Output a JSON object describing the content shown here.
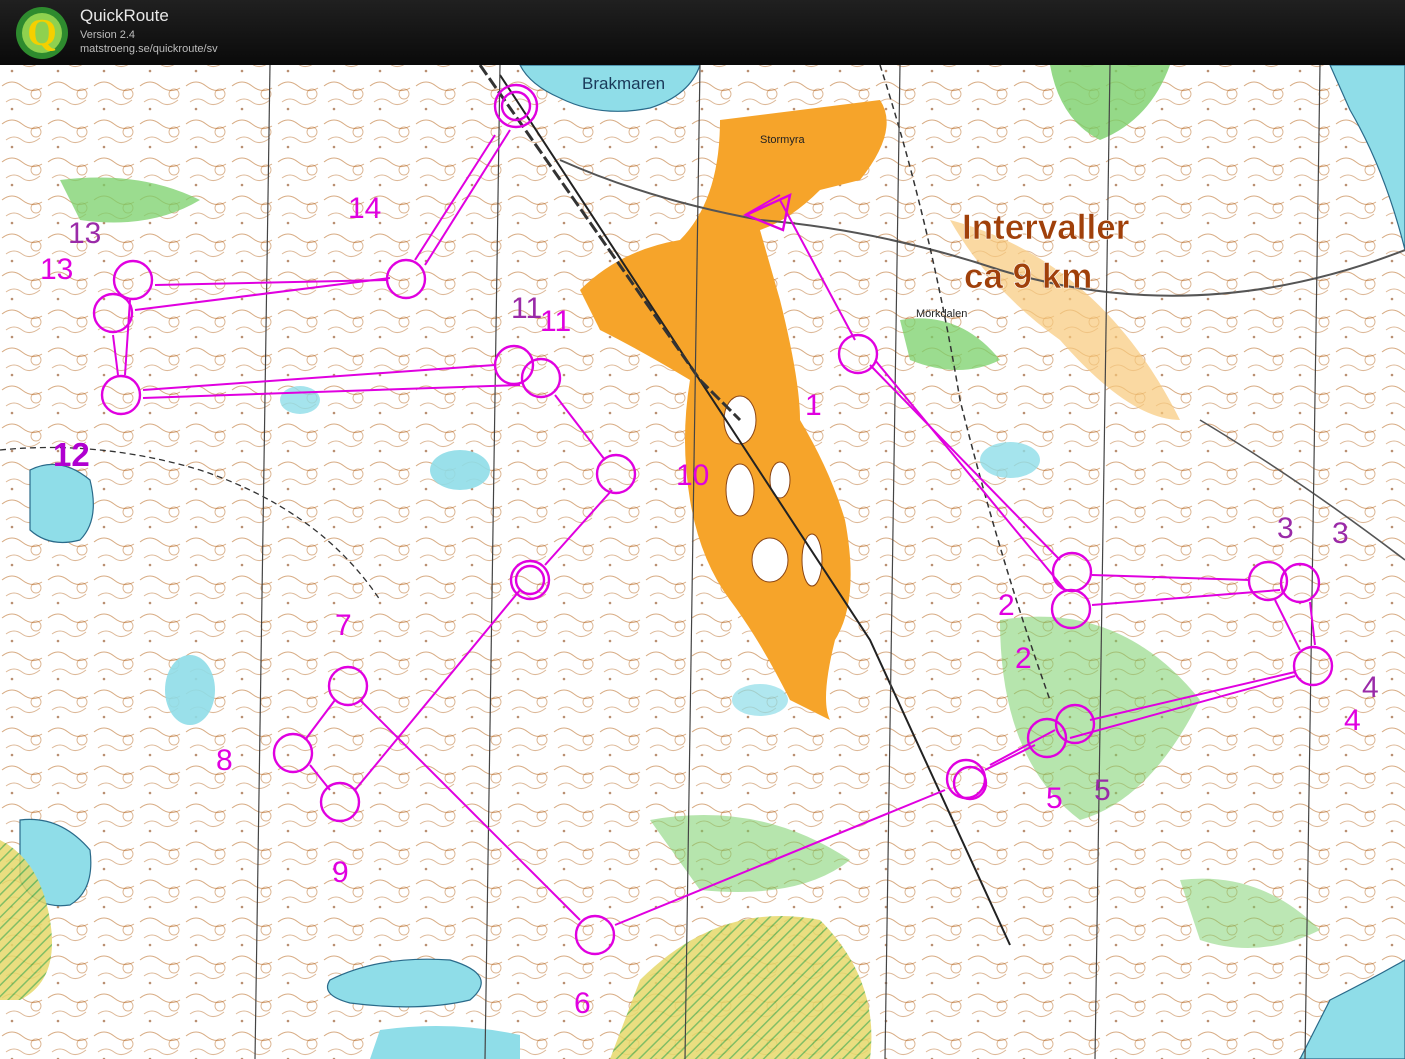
{
  "header": {
    "title": "QuickRoute",
    "version": "Version 2.4",
    "url": "matstroeng.se/quickroute/sv",
    "logo_letter": "Q"
  },
  "map": {
    "title_line1": "Intervaller",
    "title_line2": "ca 9 km",
    "places": {
      "lake_north": "Brakmaren",
      "marsh": "Stormyra",
      "valley": "Mörkdalen"
    },
    "controls": {
      "c1": "1",
      "c2a": "2",
      "c2b": "2",
      "c3a": "3",
      "c3b": "3",
      "c4a": "4",
      "c4b": "4",
      "c5a": "5",
      "c5b": "5",
      "c6": "6",
      "c7": "7",
      "c8": "8",
      "c9": "9",
      "c10": "10",
      "c11a": "11",
      "c11b": "11",
      "c12": "12",
      "c13a": "13",
      "c13b": "13",
      "c14": "14"
    },
    "colors": {
      "course": "#e000e0",
      "terrain": "#ffffff",
      "water": "#8fdde8",
      "open_land": "#f6a42a",
      "vegetation": "#7ad06a",
      "contour": "#a0522d",
      "title_text": "#a0400a"
    }
  }
}
